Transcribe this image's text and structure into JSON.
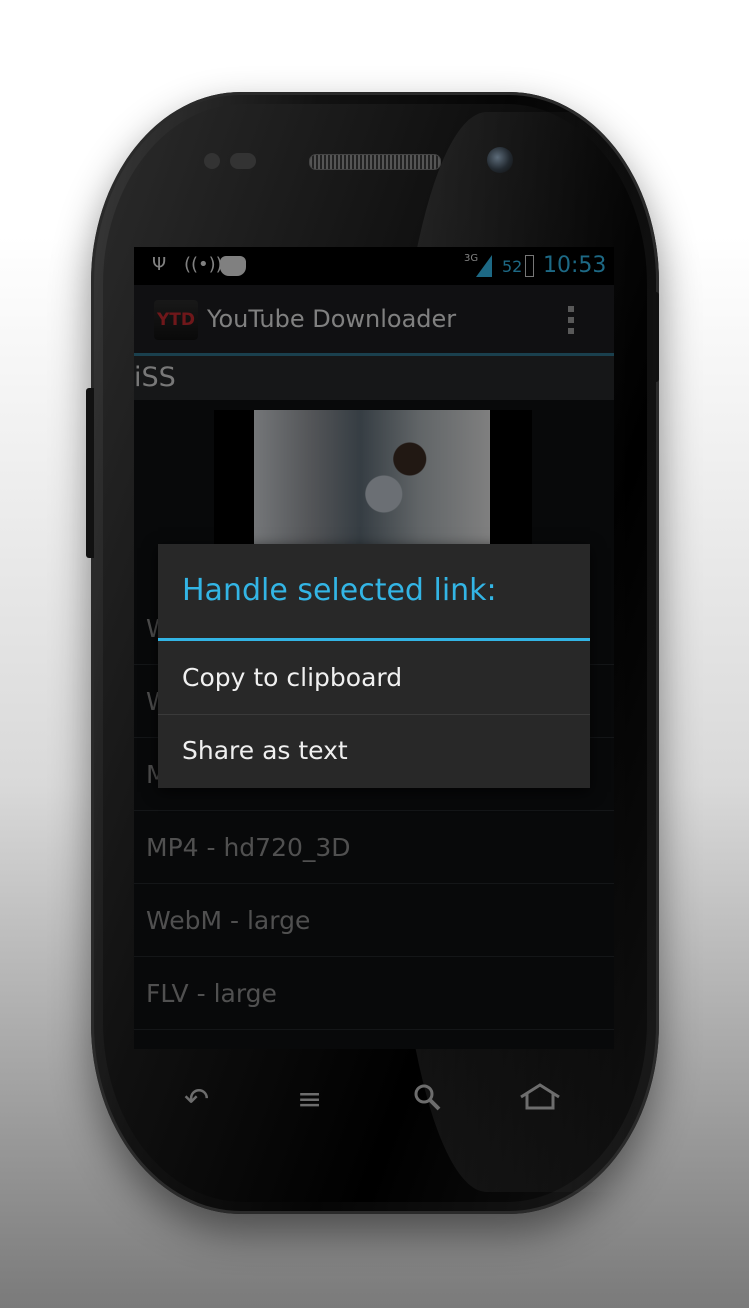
{
  "status_bar": {
    "network": "3G",
    "battery_percent": "52",
    "time": "10:53",
    "icons": [
      "usb-icon",
      "wireless-signal-icon",
      "cyanogen-mascot-icon",
      "cell-signal-icon",
      "battery-icon"
    ]
  },
  "action_bar": {
    "logo_text": "YTD",
    "title": "YouTube Downloader",
    "overflow_icon": "overflow-menu-icon"
  },
  "video": {
    "title": "iSS"
  },
  "formats": [
    {
      "label": "W"
    },
    {
      "label": "W"
    },
    {
      "label": "M"
    },
    {
      "label": "MP4 - hd720_3D"
    },
    {
      "label": "WebM - large"
    },
    {
      "label": "FLV - large"
    }
  ],
  "dialog": {
    "title": "Handle selected link:",
    "items": [
      {
        "label": "Copy to clipboard"
      },
      {
        "label": "Share as text"
      }
    ]
  },
  "nav_bar": {
    "icons": [
      "back-icon",
      "menu-icon",
      "search-icon",
      "home-icon"
    ]
  },
  "colors": {
    "accent": "#33b5e5",
    "logo_red": "#c0282d"
  }
}
